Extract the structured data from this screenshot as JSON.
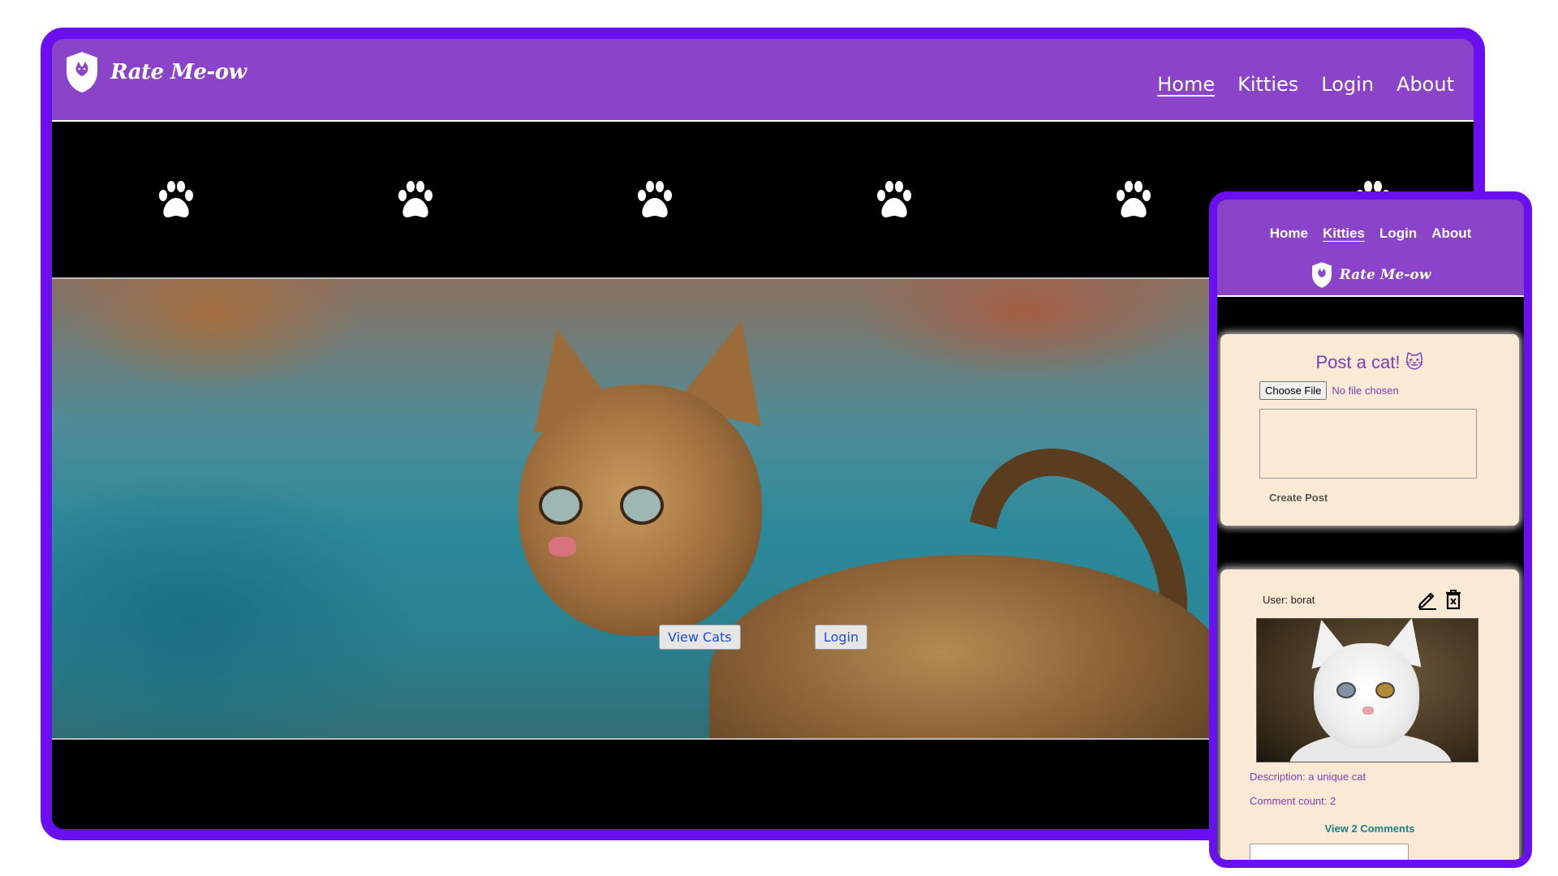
{
  "desktop": {
    "brand": "Rate Me-ow",
    "nav": [
      {
        "label": "Home",
        "active": true
      },
      {
        "label": "Kitties",
        "active": false
      },
      {
        "label": "Login",
        "active": false
      },
      {
        "label": "About",
        "active": false
      }
    ],
    "hero_buttons": {
      "view_cats": "View Cats",
      "login": "Login"
    },
    "colors": {
      "frame": "#6a0ff0",
      "header": "#8a43c9",
      "background": "#000000"
    }
  },
  "mobile": {
    "brand": "Rate Me-ow",
    "nav": [
      {
        "label": "Home",
        "active": false
      },
      {
        "label": "Kitties",
        "active": true
      },
      {
        "label": "Login",
        "active": false
      },
      {
        "label": "About",
        "active": false
      }
    ],
    "post_form": {
      "title": "Post a cat! 🐱",
      "file_button": "Choose File",
      "file_status": "No file chosen",
      "textarea_value": "",
      "submit": "Create Post"
    },
    "feed": [
      {
        "user": "User: borat",
        "description": "Description: a unique cat",
        "comment_count": "Comment count: 2",
        "view_comments": "View 2 Comments"
      }
    ],
    "colors": {
      "card": "#fae9d5",
      "accent_text": "#7a3fb8",
      "link": "#1c7f86"
    }
  },
  "icons": [
    "shield-cat-logo-icon",
    "paw-icon",
    "edit-pencil-icon",
    "trash-icon"
  ]
}
